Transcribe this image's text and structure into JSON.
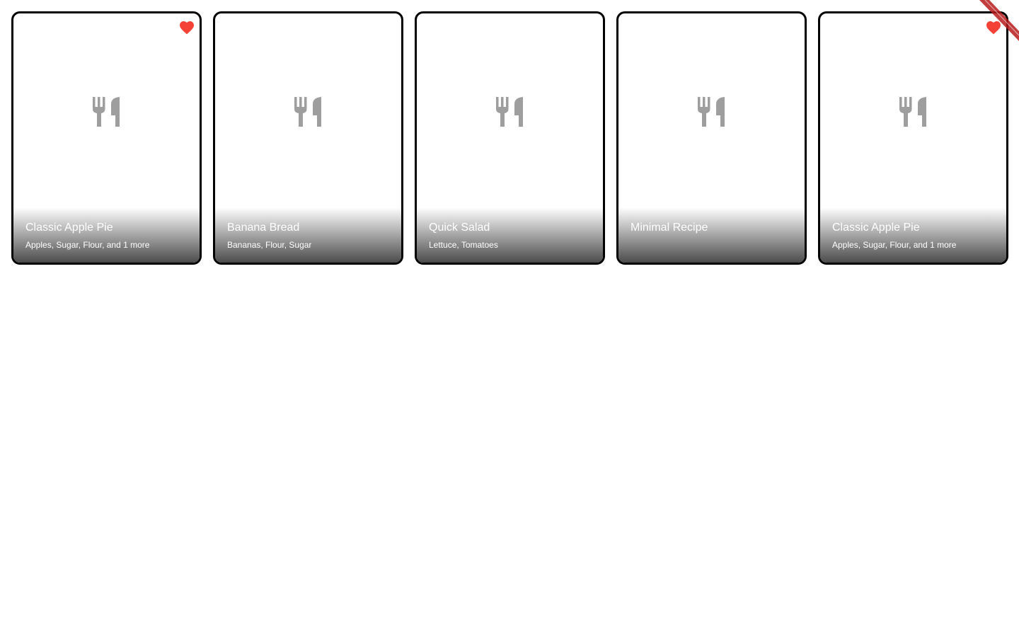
{
  "cards": [
    {
      "title": "Classic Apple Pie",
      "subtitle": "Apples, Sugar, Flour, and 1 more",
      "favorite": true
    },
    {
      "title": "Banana Bread",
      "subtitle": "Bananas, Flour, Sugar",
      "favorite": false
    },
    {
      "title": "Quick Salad",
      "subtitle": "Lettuce, Tomatoes",
      "favorite": false
    },
    {
      "title": "Minimal Recipe",
      "subtitle": "",
      "favorite": false
    },
    {
      "title": "Classic Apple Pie",
      "subtitle": "Apples, Sugar, Flour, and 1 more",
      "favorite": true
    }
  ],
  "icons": {
    "placeholder": "restaurant-icon",
    "favorite": "heart-icon"
  },
  "colors": {
    "card_border": "#000000",
    "placeholder_icon": "#9e9e9e",
    "favorite": "#f44336",
    "banner": "#b71c1c"
  }
}
